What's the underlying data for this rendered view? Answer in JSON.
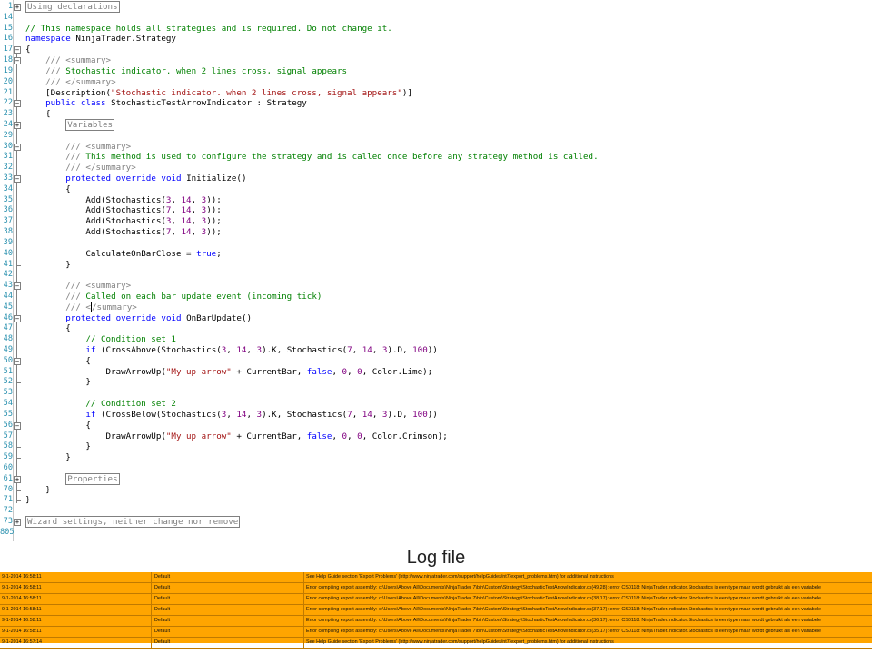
{
  "editor": {
    "lines": [
      {
        "n": "1",
        "fold": "+",
        "html": "<span class=\"box\">Using declarations</span>"
      },
      {
        "n": "14",
        "html": ""
      },
      {
        "n": "15",
        "html": "<span class=\"cm\">// This namespace holds all strategies and is required. Do not change it.</span>"
      },
      {
        "n": "16",
        "html": "<span class=\"kw\">namespace</span> NinjaTrader.Strategy"
      },
      {
        "n": "17",
        "fold": "-",
        "html": "{"
      },
      {
        "n": "18",
        "fold": "-",
        "html": "    <span class=\"xd\">///</span> <span class=\"xd\">&lt;summary&gt;</span>"
      },
      {
        "n": "19",
        "html": "    <span class=\"xd\">///</span><span class=\"cm\"> Stochastic indicator. when 2 lines cross, signal appears</span>"
      },
      {
        "n": "20",
        "html": "    <span class=\"xd\">///</span> <span class=\"xd\">&lt;/summary&gt;</span>"
      },
      {
        "n": "21",
        "html": "    [Description(<span class=\"st\">\"Stochastic indicator. when 2 lines cross, signal appears\"</span>)]"
      },
      {
        "n": "22",
        "fold": "-",
        "html": "    <span class=\"kw\">public</span> <span class=\"kw\">class</span> StochasticTestArrowIndicator : Strategy"
      },
      {
        "n": "23",
        "html": "    {"
      },
      {
        "n": "24",
        "fold": "+",
        "html": "        <span class=\"box\">Variables</span>"
      },
      {
        "n": "29",
        "html": ""
      },
      {
        "n": "30",
        "fold": "-",
        "html": "        <span class=\"xd\">///</span> <span class=\"xd\">&lt;summary&gt;</span>"
      },
      {
        "n": "31",
        "html": "        <span class=\"xd\">///</span><span class=\"cm\"> This method is used to configure the strategy and is called once before any strategy method is called.</span>"
      },
      {
        "n": "32",
        "html": "        <span class=\"xd\">///</span> <span class=\"xd\">&lt;/summary&gt;</span>"
      },
      {
        "n": "33",
        "fold": "-",
        "html": "        <span class=\"kw\">protected</span> <span class=\"kw\">override</span> <span class=\"kw\">void</span> Initialize()"
      },
      {
        "n": "34",
        "html": "        {"
      },
      {
        "n": "35",
        "html": "            Add(Stochastics(<span class=\"nm\">3</span>, <span class=\"nm\">14</span>, <span class=\"nm\">3</span>));"
      },
      {
        "n": "36",
        "html": "            Add(Stochastics(<span class=\"nm\">7</span>, <span class=\"nm\">14</span>, <span class=\"nm\">3</span>));"
      },
      {
        "n": "37",
        "html": "            Add(Stochastics(<span class=\"nm\">3</span>, <span class=\"nm\">14</span>, <span class=\"nm\">3</span>));"
      },
      {
        "n": "38",
        "html": "            Add(Stochastics(<span class=\"nm\">7</span>, <span class=\"nm\">14</span>, <span class=\"nm\">3</span>));"
      },
      {
        "n": "39",
        "html": ""
      },
      {
        "n": "40",
        "html": "            CalculateOnBarClose = <span class=\"kw\">true</span>;"
      },
      {
        "n": "41",
        "end": true,
        "html": "        }"
      },
      {
        "n": "42",
        "html": ""
      },
      {
        "n": "43",
        "fold": "-",
        "html": "        <span class=\"xd\">///</span> <span class=\"xd\">&lt;summary&gt;</span>"
      },
      {
        "n": "44",
        "html": "        <span class=\"xd\">///</span><span class=\"cm\"> Called on each bar update event (incoming tick)</span>"
      },
      {
        "n": "45",
        "html": "        <span class=\"xd\">///</span> <span class=\"xd\">&lt;<span class=\"caret\"></span>/summary&gt;</span>"
      },
      {
        "n": "46",
        "fold": "-",
        "html": "        <span class=\"kw\">protected</span> <span class=\"kw\">override</span> <span class=\"kw\">void</span> OnBarUpdate()"
      },
      {
        "n": "47",
        "html": "        {"
      },
      {
        "n": "48",
        "html": "            <span class=\"cm\">// Condition set 1</span>"
      },
      {
        "n": "49",
        "html": "            <span class=\"kw\">if</span> (CrossAbove(Stochastics(<span class=\"nm\">3</span>, <span class=\"nm\">14</span>, <span class=\"nm\">3</span>).K, Stochastics(<span class=\"nm\">7</span>, <span class=\"nm\">14</span>, <span class=\"nm\">3</span>).D, <span class=\"nm\">100</span>))"
      },
      {
        "n": "50",
        "fold": "-",
        "html": "            {"
      },
      {
        "n": "51",
        "html": "                DrawArrowUp(<span class=\"st\">\"My up arrow\"</span> + CurrentBar, <span class=\"kw\">false</span>, <span class=\"nm\">0</span>, <span class=\"nm\">0</span>, Color.Lime);"
      },
      {
        "n": "52",
        "end": true,
        "html": "            }"
      },
      {
        "n": "53",
        "html": ""
      },
      {
        "n": "54",
        "html": "            <span class=\"cm\">// Condition set 2</span>"
      },
      {
        "n": "55",
        "html": "            <span class=\"kw\">if</span> (CrossBelow(Stochastics(<span class=\"nm\">3</span>, <span class=\"nm\">14</span>, <span class=\"nm\">3</span>).K, Stochastics(<span class=\"nm\">7</span>, <span class=\"nm\">14</span>, <span class=\"nm\">3</span>).D, <span class=\"nm\">100</span>))"
      },
      {
        "n": "56",
        "fold": "-",
        "html": "            {"
      },
      {
        "n": "57",
        "html": "                DrawArrowUp(<span class=\"st\">\"My up arrow\"</span> + CurrentBar, <span class=\"kw\">false</span>, <span class=\"nm\">0</span>, <span class=\"nm\">0</span>, Color.Crimson);"
      },
      {
        "n": "58",
        "end": true,
        "html": "            }"
      },
      {
        "n": "59",
        "end": true,
        "html": "        }"
      },
      {
        "n": "60",
        "html": ""
      },
      {
        "n": "61",
        "fold": "+",
        "html": "        <span class=\"box\">Properties</span>"
      },
      {
        "n": "70",
        "end": true,
        "html": "    }"
      },
      {
        "n": "71",
        "end": true,
        "html": "}"
      },
      {
        "n": "72",
        "html": ""
      },
      {
        "n": "73",
        "fold": "+",
        "html": "<span class=\"box\">Wizard settings, neither change nor remove</span>"
      },
      {
        "n": "805",
        "html": ""
      }
    ]
  },
  "log": {
    "title": "Log file",
    "rows": [
      {
        "time": "9-1-2014 16:58:11",
        "category": "Default",
        "message": "See Help Guide section 'Export Problems' (http://www.ninjatrader.com/support/helpGuides/nt7/export_problems.htm) for additional instructions"
      },
      {
        "time": "9-1-2014 16:58:11",
        "category": "Default",
        "message": "Error compiling export assembly: c:\\Users\\Above    All\\Documents\\NinjaTrader 7\\bin\\Custom\\Strategy\\StochasticTestArrowIndicator.cs(49,28):  error CS0118: NinjaTrader.Indicator.Stochastics is een type maar wordt gebruikt als een variabele"
      },
      {
        "time": "9-1-2014 16:58:11",
        "category": "Default",
        "message": "Error compiling export assembly: c:\\Users\\Above    All\\Documents\\NinjaTrader 7\\bin\\Custom\\Strategy\\StochasticTestArrowIndicator.cs(38,17):  error CS0118: NinjaTrader.Indicator.Stochastics is een type maar wordt gebruikt als een variabele"
      },
      {
        "time": "9-1-2014 16:58:11",
        "category": "Default",
        "message": "Error compiling export assembly: c:\\Users\\Above    All\\Documents\\NinjaTrader 7\\bin\\Custom\\Strategy\\StochasticTestArrowIndicator.cs(37,17):  error CS0118: NinjaTrader.Indicator.Stochastics is een type maar wordt gebruikt als een variabele"
      },
      {
        "time": "9-1-2014 16:58:11",
        "category": "Default",
        "message": "Error compiling export assembly: c:\\Users\\Above    All\\Documents\\NinjaTrader 7\\bin\\Custom\\Strategy\\StochasticTestArrowIndicator.cs(36,17):  error CS0118: NinjaTrader.Indicator.Stochastics is een type maar wordt gebruikt als een variabele"
      },
      {
        "time": "9-1-2014 16:58:11",
        "category": "Default",
        "message": "Error compiling export assembly: c:\\Users\\Above    All\\Documents\\NinjaTrader 7\\bin\\Custom\\Strategy\\StochasticTestArrowIndicator.cs(35,17):  error CS0118: NinjaTrader.Indicator.Stochastics is een type maar wordt gebruikt als een variabele"
      },
      {
        "time": "9-1-2014 16:57:14",
        "category": "Default",
        "message": "See Help Guide section 'Export Problems' (http://www.ninjatrader.com/support/helpGuides/nt7/export_problems.htm) for additional instructions"
      }
    ]
  }
}
